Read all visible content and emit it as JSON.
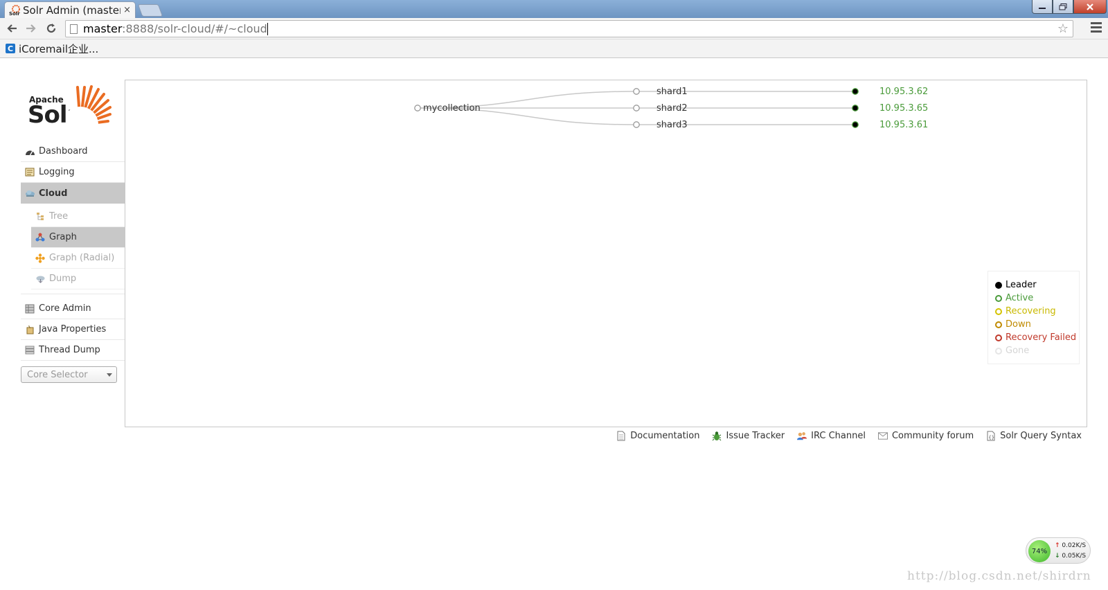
{
  "browser": {
    "tab_title": "Solr Admin (master",
    "tab_close": "×",
    "url_host": "master",
    "url_path": ":8888/solr-cloud/#/~cloud",
    "bookmark_icon_letter": "C",
    "bookmark_label": "iCoremail企业..."
  },
  "logo": {
    "apache": "Apache",
    "solr": "Solr"
  },
  "nav": {
    "items": [
      {
        "label": "Dashboard"
      },
      {
        "label": "Logging"
      },
      {
        "label": "Cloud"
      }
    ],
    "cloud_sub": [
      {
        "label": "Tree"
      },
      {
        "label": "Graph"
      },
      {
        "label": "Graph (Radial)"
      },
      {
        "label": "Dump"
      }
    ],
    "items_after": [
      {
        "label": "Core Admin"
      },
      {
        "label": "Java Properties"
      },
      {
        "label": "Thread Dump"
      }
    ],
    "core_selector": "Core Selector"
  },
  "graph": {
    "collection": "mycollection",
    "shards": [
      {
        "name": "shard1",
        "replica": "10.95.3.62"
      },
      {
        "name": "shard2",
        "replica": "10.95.3.65"
      },
      {
        "name": "shard3",
        "replica": "10.95.3.61"
      }
    ]
  },
  "legend": [
    {
      "label": "Leader",
      "color": "#000000",
      "filled": true
    },
    {
      "label": "Active",
      "color": "#4a9b3a",
      "filled": false
    },
    {
      "label": "Recovering",
      "color": "#d4c300",
      "filled": false
    },
    {
      "label": "Down",
      "color": "#c08a00",
      "filled": false
    },
    {
      "label": "Recovery Failed",
      "color": "#c0392b",
      "filled": false
    },
    {
      "label": "Gone",
      "color": "#dddddd",
      "filled": false
    }
  ],
  "footer": [
    {
      "label": "Documentation"
    },
    {
      "label": "Issue Tracker"
    },
    {
      "label": "IRC Channel"
    },
    {
      "label": "Community forum"
    },
    {
      "label": "Solr Query Syntax"
    }
  ],
  "netmon": {
    "percent": "74%",
    "up": "0.02K/S",
    "down": "0.05K/S"
  },
  "watermark": "http://blog.csdn.net/shirdrn"
}
